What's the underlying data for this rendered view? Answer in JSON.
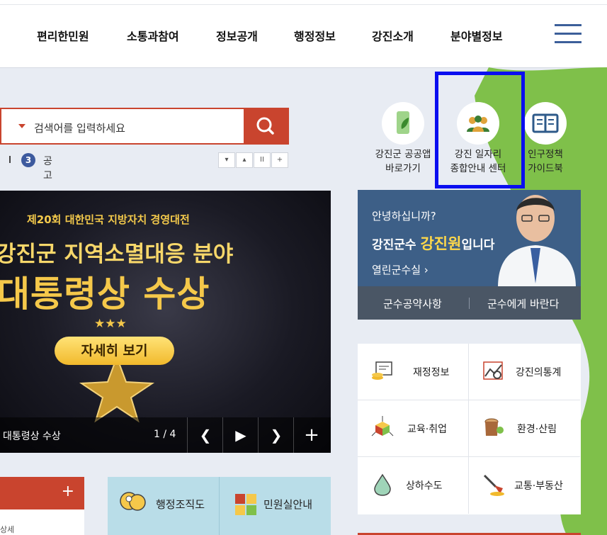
{
  "header": {
    "nav": [
      "편리한민원",
      "소통과참여",
      "정보공개",
      "행정정보",
      "강진소개",
      "분야별정보"
    ],
    "menu_icon": "hamburger-icon"
  },
  "search": {
    "placeholder": "검색어를 입력하세요",
    "button_icon": "search-icon"
  },
  "keyword": {
    "rank": "3",
    "text": "공고"
  },
  "keyword_controls": [
    "▾",
    "▴",
    "II",
    "+"
  ],
  "banner": {
    "line1": "제20회 대한민국 지방자치 경영대전",
    "line2": "강진군 지역소멸대응 분야",
    "line3": "대통령상 수상",
    "stars": "★★★",
    "button": "자세히 보기",
    "caption": "대통령상 수상",
    "page": "1 / 4"
  },
  "quick_links": [
    {
      "label1": "강진군 공공앱",
      "label2": "바로가기",
      "icon": "phone-leaf-icon"
    },
    {
      "label1": "강진 일자리",
      "label2": "종합안내 센터",
      "icon": "people-group-icon"
    },
    {
      "label1": "인구정책",
      "label2": "가이드북",
      "icon": "open-book-icon"
    }
  ],
  "mayor": {
    "greeting": "안녕하십니까?",
    "intro_prefix": "강진군수 ",
    "name": "강진원",
    "intro_suffix": "입니다",
    "open_office": "열린군수실 ›",
    "pledges": "군수공약사항",
    "ask": "군수에게 바란다"
  },
  "categories": [
    {
      "label": "재정정보",
      "icon": "finance-coins-icon"
    },
    {
      "label": "강진의통계",
      "icon": "statistics-chart-icon"
    },
    {
      "label": "교육·취업",
      "icon": "education-cube-icon"
    },
    {
      "label": "환경·산림",
      "icon": "tree-stump-icon"
    },
    {
      "label": "상하수도",
      "icon": "water-drop-icon"
    },
    {
      "label": "교통·부동산",
      "icon": "shovel-icon"
    }
  ],
  "bottom": {
    "notice_plus": "+",
    "notice_more": "상세",
    "org_chart": "행정조직도",
    "civil_guide": "민원실안내"
  },
  "colors": {
    "accent_red": "#c9442e",
    "navy": "#3d5f87",
    "highlight_box": "#0a0ef0",
    "green": "#7fc04a"
  }
}
